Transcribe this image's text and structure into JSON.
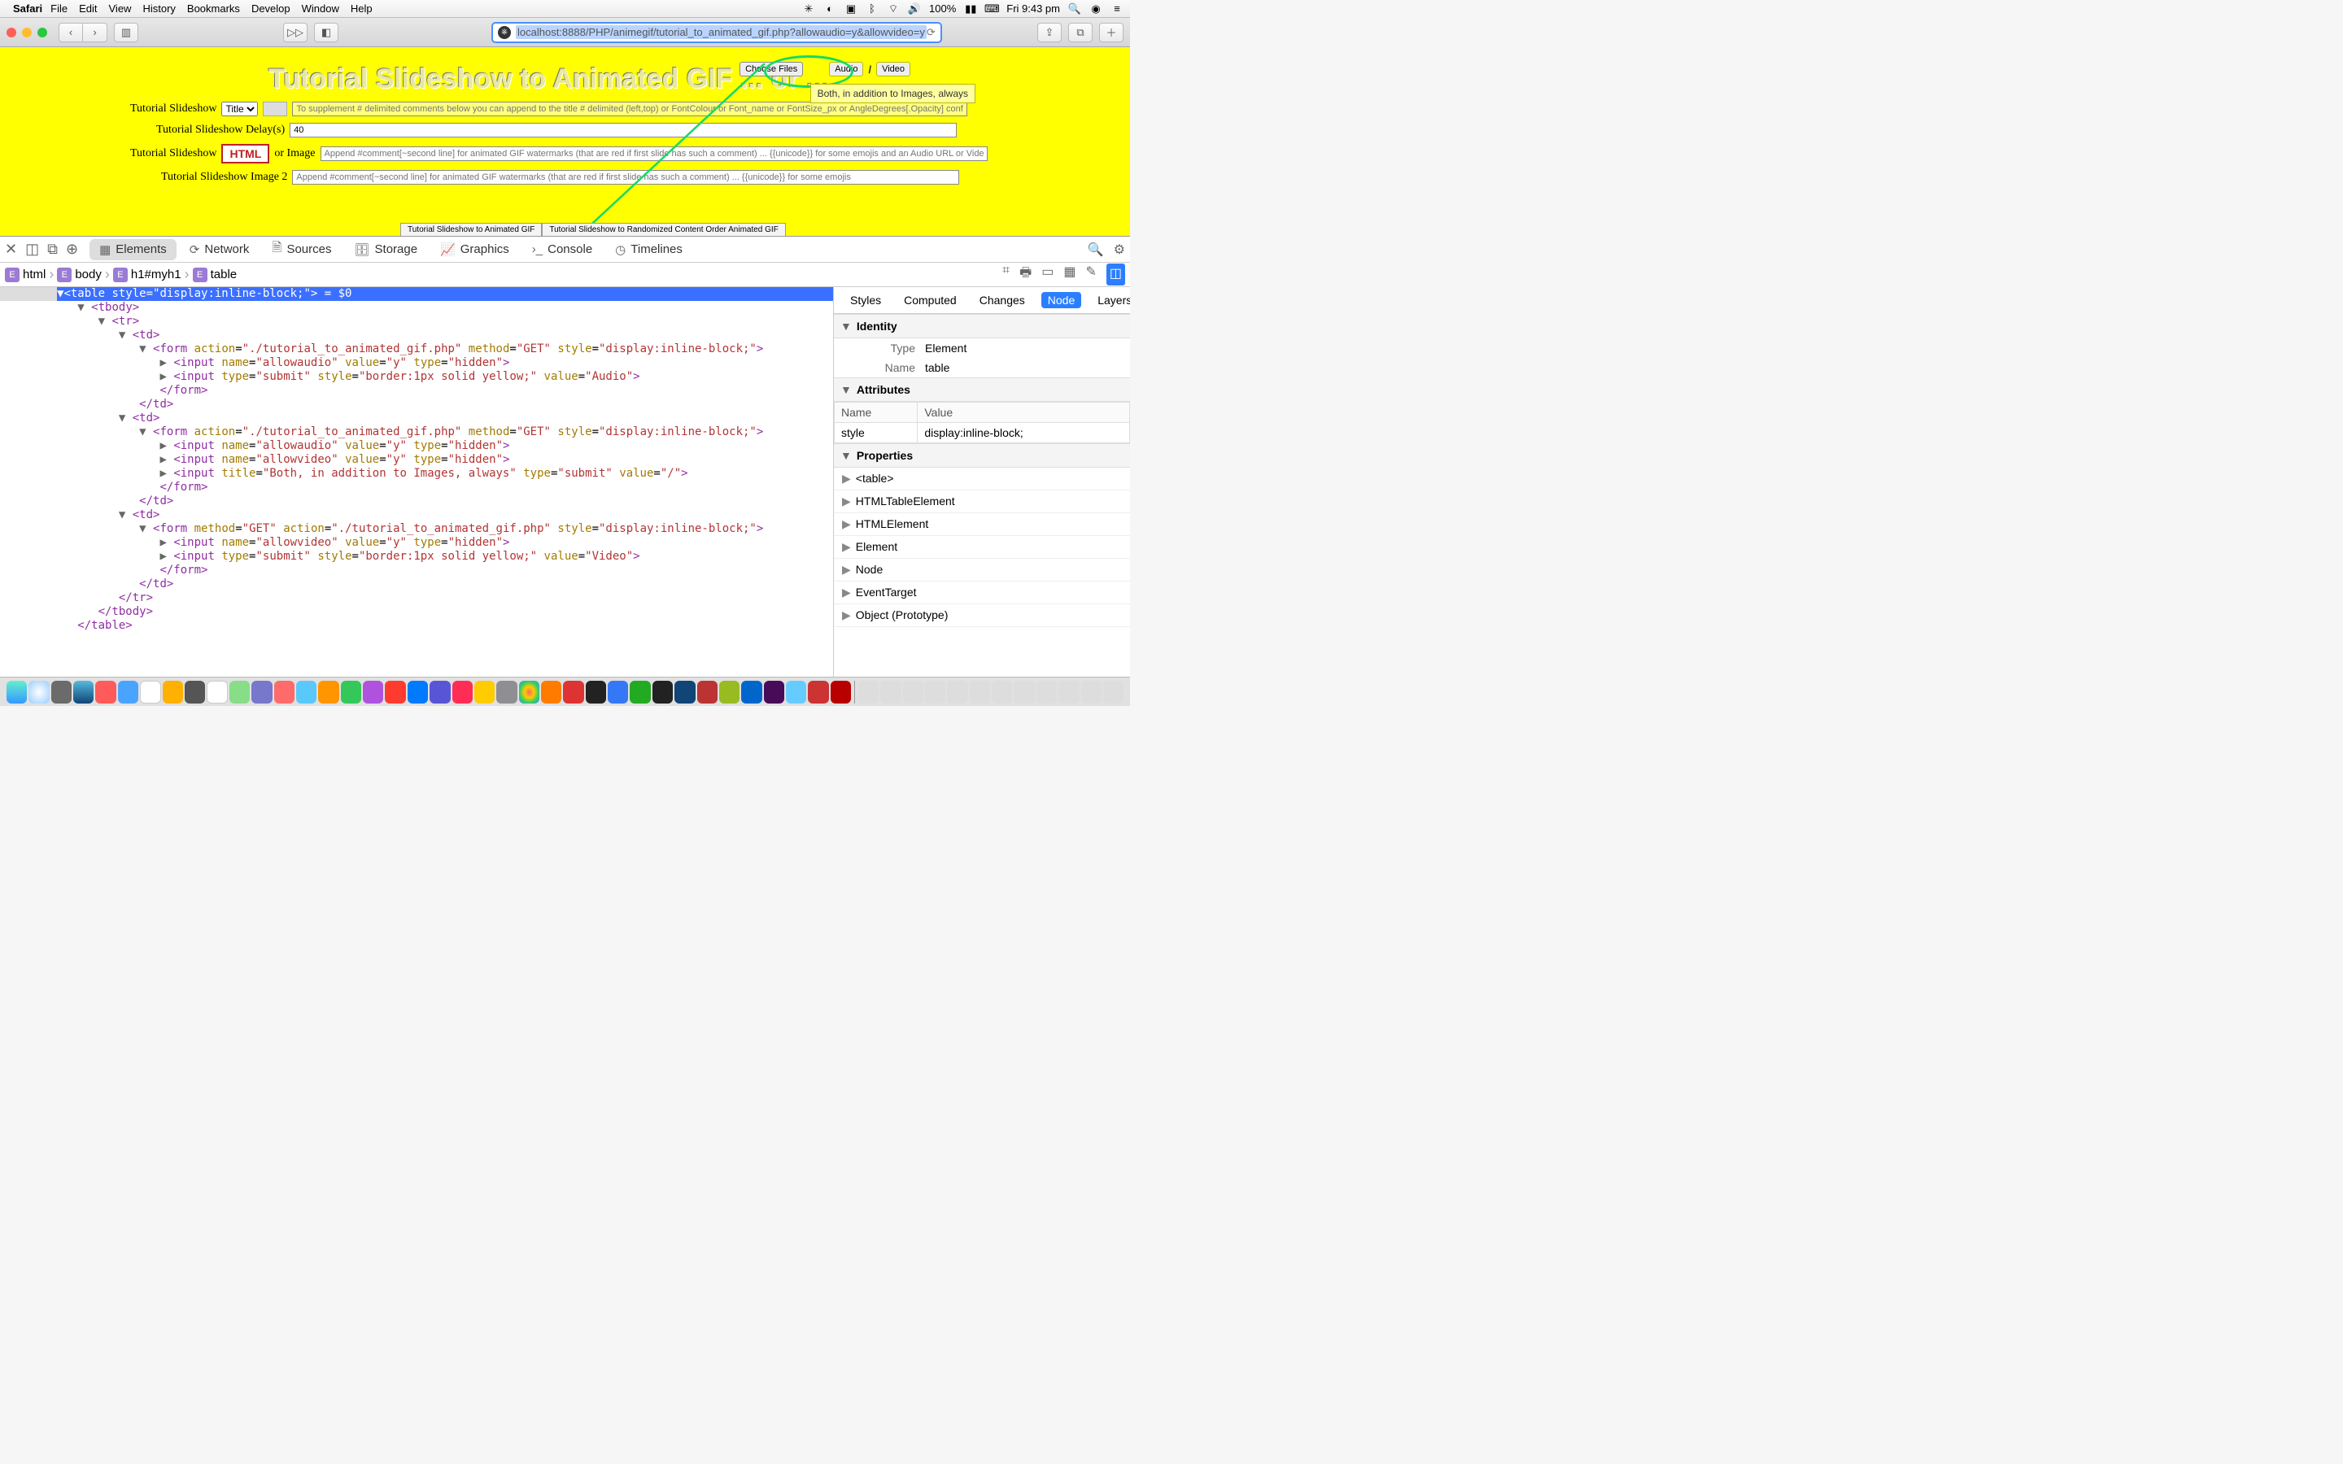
{
  "menubar": {
    "apple": "",
    "app": "Safari",
    "items": [
      "File",
      "Edit",
      "View",
      "History",
      "Bookmarks",
      "Develop",
      "Window",
      "Help"
    ],
    "battery": "100%",
    "clock": "Fri 9:43 pm"
  },
  "toolbar": {
    "url": "localhost:8888/PHP/animegif/tutorial_to_animated_gif.php?allowaudio=y&allowvideo=y"
  },
  "page": {
    "title": "Tutorial Slideshow to Animated GIF ... or ...",
    "choose_files": "Choose Files",
    "btn_audio": "Audio",
    "btn_sep": "/",
    "btn_video": "Video",
    "tooltip": "Both, in addition to Images, always",
    "row1_label": "Tutorial Slideshow",
    "row1_select": "Title",
    "row1_placeholder": "To supplement # delimited comments below you can append to the title # delimited (left,top) or FontColour or Font_name or FontSize_px or AngleDegrees[.Opacity] configurations allowed",
    "row2_label": "Tutorial Slideshow Delay(s)",
    "row2_value": "40",
    "row3_label": "Tutorial Slideshow",
    "row3_html": "HTML",
    "row3_or": "or Image",
    "row3_placeholder": "Append #comment[~second line] for animated GIF watermarks (that are red if first slide has such a comment) ... {{unicode}} for some emojis and an Audio URL or Video URL (or browsed f",
    "row4_label": "Tutorial Slideshow Image 2",
    "row4_placeholder": "Append #comment[~second line] for animated GIF watermarks (that are red if first slide has such a comment) ... {{unicode}} for some emojis",
    "tabs": [
      "Tutorial Slideshow to Animated GIF",
      "Tutorial Slideshow to Randomized Content Order Animated GIF"
    ]
  },
  "devtools": {
    "tabs": [
      "Elements",
      "Network",
      "Sources",
      "Storage",
      "Graphics",
      "Console",
      "Timelines"
    ],
    "active_tab": "Elements",
    "crumbs": [
      "html",
      "body",
      "h1#myh1",
      "table"
    ],
    "selected_line": "<table style=\"display:inline-block;\"> = $0",
    "side_tabs": [
      "Styles",
      "Computed",
      "Changes",
      "Node",
      "Layers"
    ],
    "side_active": "Node",
    "identity": {
      "heading": "Identity",
      "type_k": "Type",
      "type_v": "Element",
      "name_k": "Name",
      "name_v": "table"
    },
    "attributes": {
      "heading": "Attributes",
      "col1": "Name",
      "col2": "Value",
      "row_name": "style",
      "row_val": "display:inline-block;"
    },
    "properties": {
      "heading": "Properties",
      "items": [
        "<table>",
        "HTMLTableElement",
        "HTMLElement",
        "Element",
        "Node",
        "EventTarget",
        "Object (Prototype)"
      ]
    }
  },
  "dom": {
    "l1": "<tbody>",
    "l2": "<tr>",
    "l3": "<td>",
    "form_open": "<form action=\"./tutorial_to_animated_gif.php\" method=\"GET\" style=\"display:inline-block;\">",
    "form_open_b": "<form method=\"GET\" action=\"./tutorial_to_animated_gif.php\" style=\"display:inline-block;\">",
    "in_audio": "<input name=\"allowaudio\" value=\"y\" type=\"hidden\">",
    "in_video": "<input name=\"allowvideo\" value=\"y\" type=\"hidden\">",
    "in_sub_audio": "<input type=\"submit\" style=\"border:1px solid yellow;\" value=\"Audio\">",
    "in_sub_slash": "<input title=\"Both, in addition to Images, always\" type=\"submit\" value=\"/\">",
    "in_sub_video": "<input type=\"submit\" style=\"border:1px solid yellow;\" value=\"Video\">",
    "form_close": "</form>",
    "td_close": "</td>",
    "tr_close": "</tr>",
    "tbody_close": "</tbody>",
    "table_close": "</table>"
  }
}
